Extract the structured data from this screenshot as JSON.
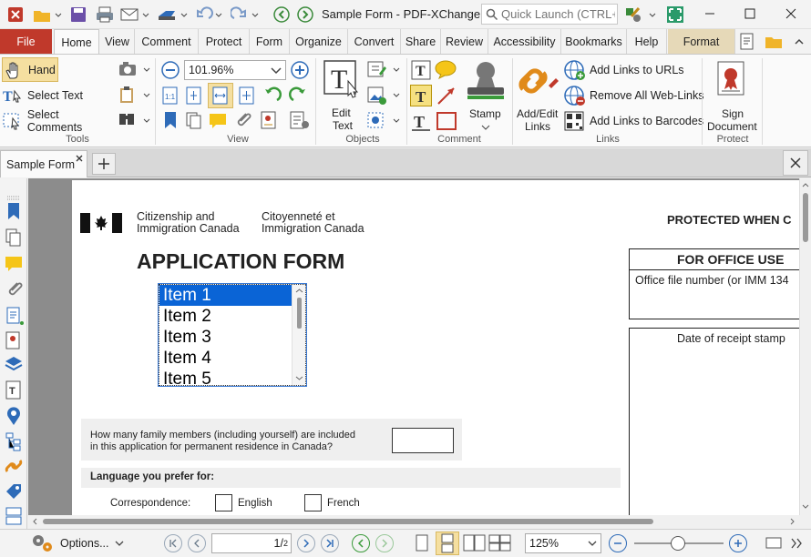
{
  "titlebar": {
    "title": "Sample Form - PDF-XChange E...",
    "quick_launch_placeholder": "Quick Launch (CTRL+.)"
  },
  "ribbon_tabs": [
    "File",
    "Home",
    "View",
    "Comment",
    "Protect",
    "Form",
    "Organize",
    "Convert",
    "Share",
    "Review",
    "Accessibility",
    "Bookmarks",
    "Help",
    "Format"
  ],
  "tools": {
    "hand": "Hand",
    "select_text": "Select Text",
    "select_comments": "Select Comments",
    "group": "Tools"
  },
  "view": {
    "zoom": "101.96%",
    "group": "View"
  },
  "objects": {
    "edit_text_1": "Edit",
    "edit_text_2": "Text",
    "group": "Objects"
  },
  "comment": {
    "stamp": "Stamp",
    "group": "Comment"
  },
  "links": {
    "add_edit_1": "Add/Edit",
    "add_edit_2": "Links",
    "add_links_urls": "Add Links to URLs",
    "remove_links": "Remove All Web-Links",
    "add_links_barcodes": "Add Links to Barcodes",
    "group": "Links"
  },
  "protect": {
    "sign_1": "Sign",
    "sign_2": "Document",
    "group": "Protect"
  },
  "doc_tab": {
    "name": "Sample Form"
  },
  "document": {
    "dept_en_1": "Citizenship and",
    "dept_en_2": "Immigration Canada",
    "dept_fr_1": "Citoyenneté et",
    "dept_fr_2": "Immigration Canada",
    "protected": "PROTECTED WHEN C",
    "form_title": "APPLICATION FORM",
    "office_use": "FOR OFFICE USE",
    "office_file": "Office file number (or IMM 134",
    "receipt": "Date of receipt stamp",
    "family_q_1": "How many family members (including yourself) are included",
    "family_q_2": "in this application for permanent residence in Canada?",
    "language_heading": "Language you prefer for:",
    "correspondence": "Correspondence:",
    "english": "English",
    "french": "French",
    "list_items": [
      "Item 1",
      "Item 2",
      "Item 3",
      "Item 4",
      "Item 5"
    ]
  },
  "statusbar": {
    "options": "Options...",
    "page_current": "1",
    "page_total": "2",
    "zoom": "125%"
  },
  "colors": {
    "file_tab": "#c0392b",
    "selection": "#0a64d6",
    "format_tab": "#e6d9b8"
  }
}
